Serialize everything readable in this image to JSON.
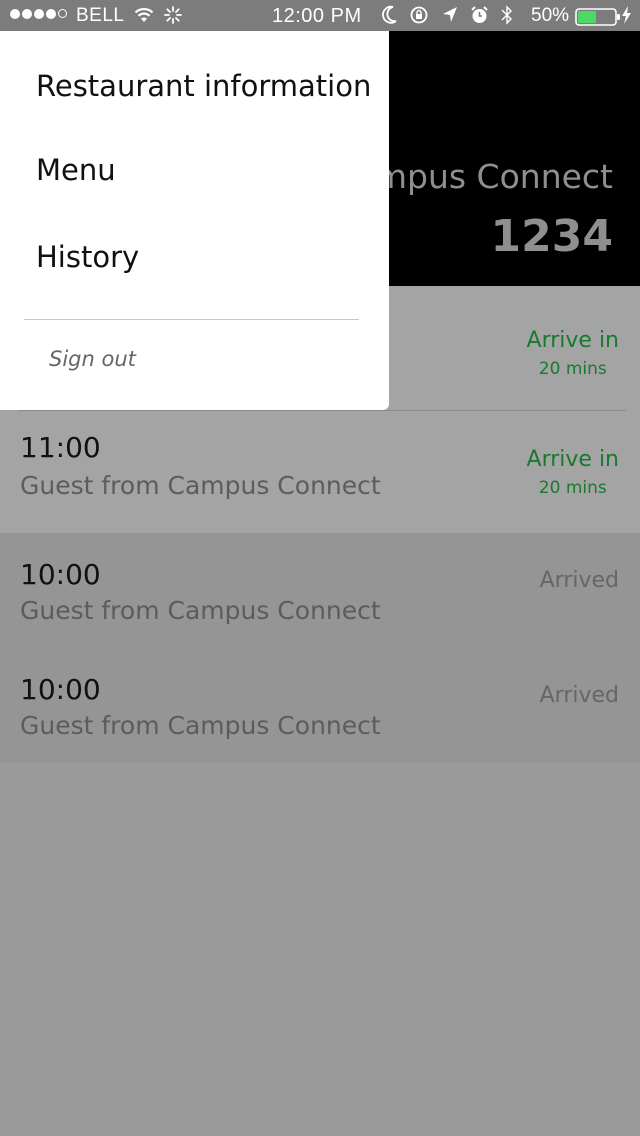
{
  "status_bar": {
    "carrier": "BELL",
    "time": "12:00 PM",
    "battery_percent": "50%",
    "battery_level": 0.5,
    "signal_bars_filled": 4,
    "signal_bars_total": 5
  },
  "header": {
    "title": "mpus Connect",
    "code": "1234"
  },
  "menu": {
    "items": [
      {
        "label": "Restaurant information"
      },
      {
        "label": "Menu"
      },
      {
        "label": "History"
      }
    ],
    "sign_out": "Sign out"
  },
  "reservations": [
    {
      "time": "",
      "guest": "",
      "status": "Arrive in",
      "status_sub": "20 mins",
      "state": "upcoming"
    },
    {
      "time": "11:00",
      "guest": "Guest from Campus Connect",
      "status": "Arrive in",
      "status_sub": "20 mins",
      "state": "upcoming"
    },
    {
      "time": "10:00",
      "guest": "Guest from Campus Connect",
      "status": "Arrived",
      "status_sub": "",
      "state": "arrived"
    },
    {
      "time": "10:00",
      "guest": "Guest from Campus Connect",
      "status": "Arrived",
      "status_sub": "",
      "state": "arrived"
    }
  ],
  "colors": {
    "status_green": "#187a2e",
    "overlay_grey": "#9a9a9a",
    "header_bg": "#000000",
    "battery_green": "#4cd964"
  },
  "icons": [
    "wifi-icon",
    "activity-spinner-icon",
    "moon-icon",
    "orientation-lock-icon",
    "location-arrow-icon",
    "alarm-icon",
    "bluetooth-icon",
    "battery-icon",
    "charging-bolt-icon"
  ]
}
